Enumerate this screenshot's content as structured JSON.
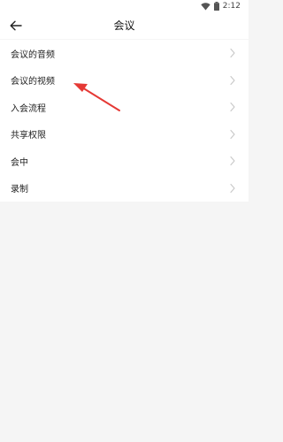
{
  "status_bar": {
    "time": "2:12",
    "wifi_icon": "wifi-icon",
    "battery_icon": "battery-icon"
  },
  "app_bar": {
    "back_icon": "arrow-left-icon",
    "title": "会议"
  },
  "menu": {
    "items": [
      {
        "label": "会议的音频",
        "chevron": "chevron-right-icon"
      },
      {
        "label": "会议的视频",
        "chevron": "chevron-right-icon"
      },
      {
        "label": "入会流程",
        "chevron": "chevron-right-icon"
      },
      {
        "label": "共享权限",
        "chevron": "chevron-right-icon"
      },
      {
        "label": "会中",
        "chevron": "chevron-right-icon"
      },
      {
        "label": "录制",
        "chevron": "chevron-right-icon"
      }
    ]
  },
  "colors": {
    "background": "#f5f5f5",
    "surface": "#ffffff",
    "text": "#222222",
    "chevron": "#c8c8c8",
    "annotation_arrow": "#e53935"
  }
}
